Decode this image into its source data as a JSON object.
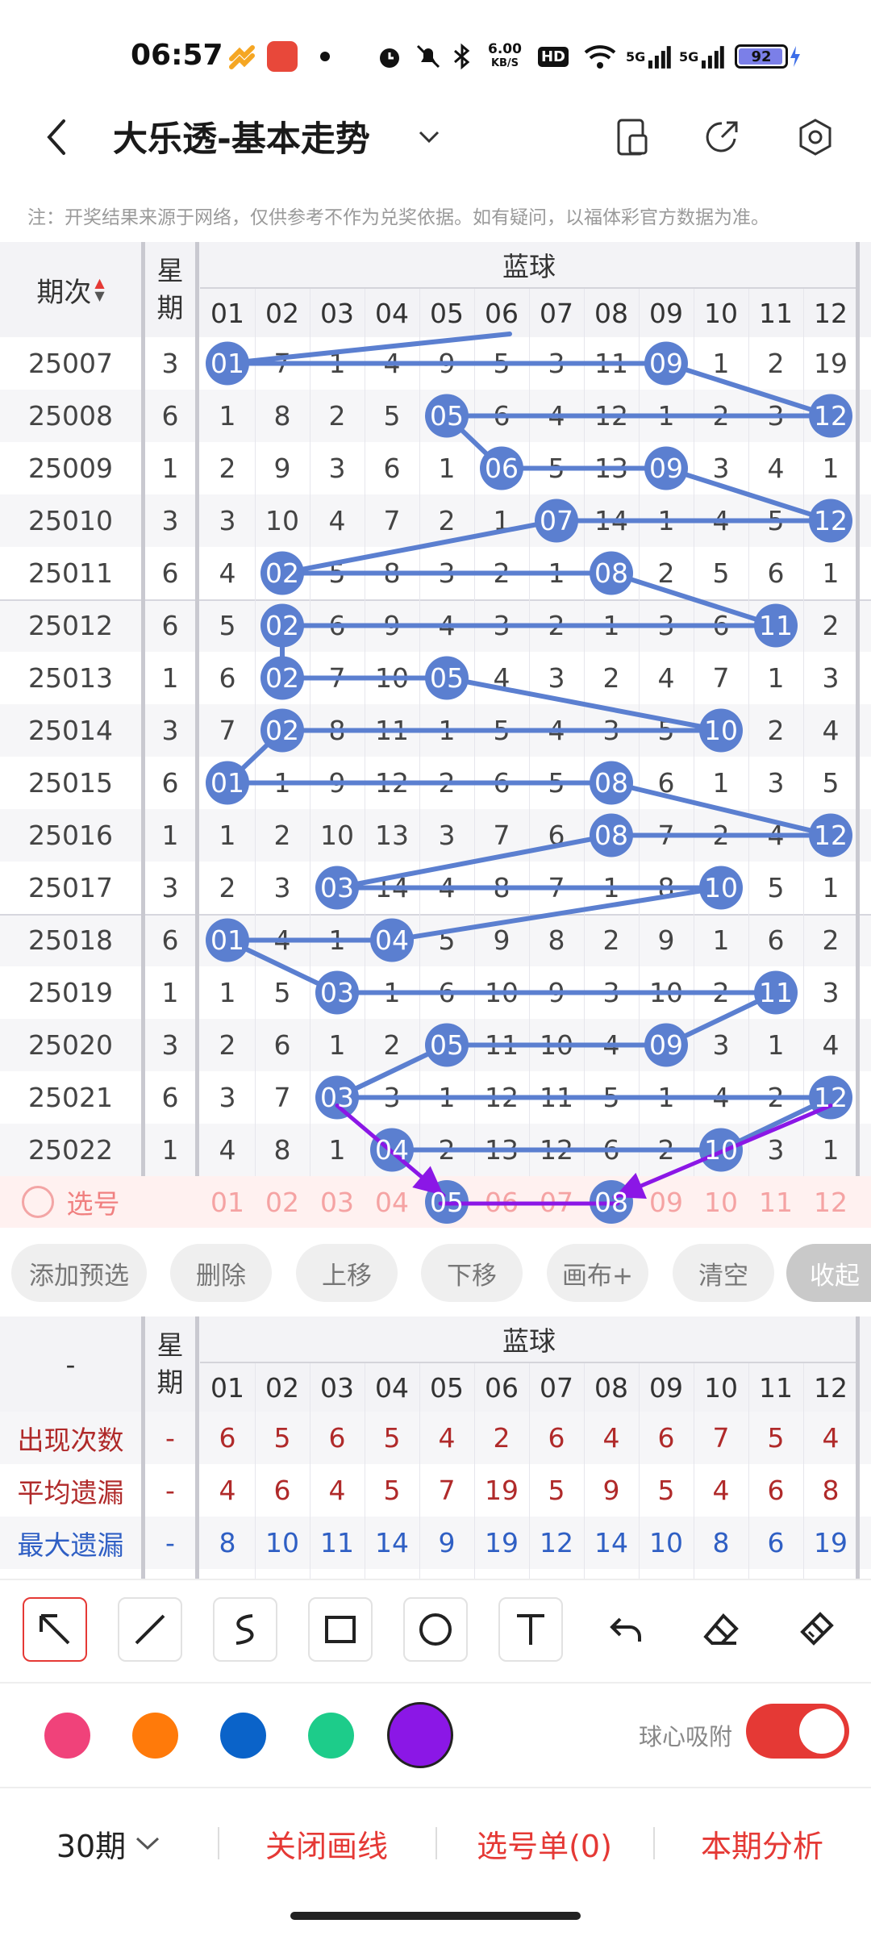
{
  "status": {
    "time": "06:57",
    "net_speed": "6.00",
    "net_unit": "KB/S",
    "hd": "HD",
    "sig1": "5G",
    "sig2": "5G",
    "battery": "92"
  },
  "header": {
    "title": "大乐透-基本走势",
    "dropdown_icon": "chevron-down-icon",
    "icons": [
      "phone-screen-icon",
      "share-icon",
      "settings-icon"
    ]
  },
  "note": "注：开奖结果来源于网络，仅供参考不作为兑奖依据。如有疑问，以福体彩官方数据为准。",
  "table": {
    "col_period": "期次",
    "col_week": "星期",
    "col_week_l1": "星",
    "col_week_l2": "期",
    "group": "蓝球",
    "numbers": [
      "01",
      "02",
      "03",
      "04",
      "05",
      "06",
      "07",
      "08",
      "09",
      "10",
      "11",
      "12"
    ],
    "rows": [
      {
        "period": "25007",
        "week": "3",
        "cells": [
          "01",
          "7",
          "1",
          "4",
          "9",
          "5",
          "3",
          "11",
          "09",
          "1",
          "2",
          "19"
        ],
        "hits": [
          0,
          8
        ]
      },
      {
        "period": "25008",
        "week": "6",
        "cells": [
          "1",
          "8",
          "2",
          "5",
          "05",
          "6",
          "4",
          "12",
          "1",
          "2",
          "3",
          "12"
        ],
        "hits": [
          4,
          11
        ]
      },
      {
        "period": "25009",
        "week": "1",
        "cells": [
          "2",
          "9",
          "3",
          "6",
          "1",
          "06",
          "5",
          "13",
          "09",
          "3",
          "4",
          "1"
        ],
        "hits": [
          5,
          8
        ]
      },
      {
        "period": "25010",
        "week": "3",
        "cells": [
          "3",
          "10",
          "4",
          "7",
          "2",
          "1",
          "07",
          "14",
          "1",
          "4",
          "5",
          "12"
        ],
        "hits": [
          6,
          11
        ]
      },
      {
        "period": "25011",
        "week": "6",
        "cells": [
          "4",
          "02",
          "5",
          "8",
          "3",
          "2",
          "1",
          "08",
          "2",
          "5",
          "6",
          "1"
        ],
        "hits": [
          1,
          7
        ]
      },
      {
        "period": "25012",
        "week": "6",
        "cells": [
          "5",
          "02",
          "6",
          "9",
          "4",
          "3",
          "2",
          "1",
          "3",
          "6",
          "11",
          "2"
        ],
        "hits": [
          1,
          10
        ]
      },
      {
        "period": "25013",
        "week": "1",
        "cells": [
          "6",
          "02",
          "7",
          "10",
          "05",
          "4",
          "3",
          "2",
          "4",
          "7",
          "1",
          "3"
        ],
        "hits": [
          1,
          4
        ]
      },
      {
        "period": "25014",
        "week": "3",
        "cells": [
          "7",
          "02",
          "8",
          "11",
          "1",
          "5",
          "4",
          "3",
          "5",
          "10",
          "2",
          "4"
        ],
        "hits": [
          1,
          9
        ]
      },
      {
        "period": "25015",
        "week": "6",
        "cells": [
          "01",
          "1",
          "9",
          "12",
          "2",
          "6",
          "5",
          "08",
          "6",
          "1",
          "3",
          "5"
        ],
        "hits": [
          0,
          7
        ]
      },
      {
        "period": "25016",
        "week": "1",
        "cells": [
          "1",
          "2",
          "10",
          "13",
          "3",
          "7",
          "6",
          "08",
          "7",
          "2",
          "4",
          "12"
        ],
        "hits": [
          7,
          11
        ]
      },
      {
        "period": "25017",
        "week": "3",
        "cells": [
          "2",
          "3",
          "03",
          "14",
          "4",
          "8",
          "7",
          "1",
          "8",
          "10",
          "5",
          "1"
        ],
        "hits": [
          2,
          9
        ]
      },
      {
        "period": "25018",
        "week": "6",
        "cells": [
          "01",
          "4",
          "1",
          "04",
          "5",
          "9",
          "8",
          "2",
          "9",
          "1",
          "6",
          "2"
        ],
        "hits": [
          0,
          3
        ]
      },
      {
        "period": "25019",
        "week": "1",
        "cells": [
          "1",
          "5",
          "03",
          "1",
          "6",
          "10",
          "9",
          "3",
          "10",
          "2",
          "11",
          "3"
        ],
        "hits": [
          2,
          10
        ]
      },
      {
        "period": "25020",
        "week": "3",
        "cells": [
          "2",
          "6",
          "1",
          "2",
          "05",
          "11",
          "10",
          "4",
          "09",
          "3",
          "1",
          "4"
        ],
        "hits": [
          4,
          8
        ]
      },
      {
        "period": "25021",
        "week": "6",
        "cells": [
          "3",
          "7",
          "03",
          "3",
          "1",
          "12",
          "11",
          "5",
          "1",
          "4",
          "2",
          "12"
        ],
        "hits": [
          2,
          11
        ]
      },
      {
        "period": "25022",
        "week": "1",
        "cells": [
          "4",
          "8",
          "1",
          "04",
          "2",
          "13",
          "12",
          "6",
          "2",
          "10",
          "3",
          "1"
        ],
        "hits": [
          3,
          9
        ]
      }
    ],
    "pick_label": "选号",
    "pick_selected": [
      4,
      7
    ]
  },
  "actions": {
    "add": "添加预选",
    "delete": "删除",
    "up": "上移",
    "down": "下移",
    "canvas": "画布+",
    "clear": "清空",
    "collapse": "收起"
  },
  "stats": {
    "dash": "-",
    "week_l1": "星",
    "week_l2": "期",
    "group": "蓝球",
    "rows": [
      {
        "label": "出现次数",
        "week": "-",
        "values": [
          "6",
          "5",
          "6",
          "5",
          "4",
          "2",
          "6",
          "4",
          "6",
          "7",
          "5",
          "4"
        ],
        "color": "#b02a2a"
      },
      {
        "label": "平均遗漏",
        "week": "-",
        "values": [
          "4",
          "6",
          "4",
          "5",
          "7",
          "19",
          "5",
          "9",
          "5",
          "4",
          "6",
          "8"
        ],
        "color": "#b02a2a"
      },
      {
        "label": "最大遗漏",
        "week": "-",
        "values": [
          "8",
          "10",
          "11",
          "14",
          "9",
          "19",
          "12",
          "14",
          "10",
          "8",
          "6",
          "19"
        ],
        "color": "#2f5fc4"
      }
    ]
  },
  "tools": [
    "arrow-tool-icon",
    "line-tool-icon",
    "curve-tool-icon",
    "rect-tool-icon",
    "circle-tool-icon",
    "text-tool-icon",
    "undo-icon",
    "eraser-icon",
    "brush-icon"
  ],
  "colors": {
    "pink": "#f0427a",
    "orange": "#ff7a0a",
    "blue": "#0a63c9",
    "green": "#1dcc8a",
    "purple": "#8b17e6",
    "accent": "#e53935",
    "ball": "#5b7fd0",
    "line": "#5b7fd0"
  },
  "snap": {
    "label": "球心吸附",
    "on": true
  },
  "bottom": {
    "periods": "30期",
    "close_lines": "关闭画线",
    "pick_list": "选号单(0)",
    "analysis": "本期分析"
  }
}
